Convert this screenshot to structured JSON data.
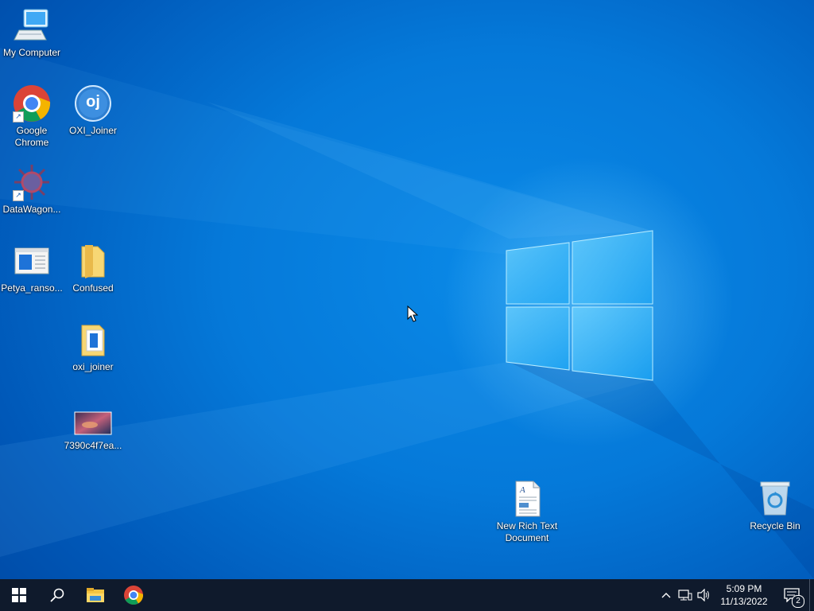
{
  "desktop": {
    "icons": [
      {
        "id": "my-computer",
        "label": "My Computer"
      },
      {
        "id": "google-chrome",
        "label": "Google Chrome"
      },
      {
        "id": "oxi-joiner-app",
        "label": "OXI_Joiner",
        "glyph": "oj"
      },
      {
        "id": "datawagon",
        "label": "DataWagon..."
      },
      {
        "id": "petya",
        "label": "Petya_ranso..."
      },
      {
        "id": "confused",
        "label": "Confused"
      },
      {
        "id": "oxi-joiner-folder",
        "label": "oxi_joiner"
      },
      {
        "id": "image-file",
        "label": "7390c4f7ea..."
      },
      {
        "id": "rich-text",
        "label": "New Rich Text Document"
      },
      {
        "id": "recycle-bin",
        "label": "Recycle Bin"
      }
    ]
  },
  "taskbar": {
    "clock_time": "5:09 PM",
    "clock_date": "11/13/2022",
    "notification_count": "2",
    "tray_chevron": "^"
  },
  "colors": {
    "wallpaper": "#0078d7",
    "taskbar": "#0f1a2c",
    "accent": "#4cc2ff"
  }
}
